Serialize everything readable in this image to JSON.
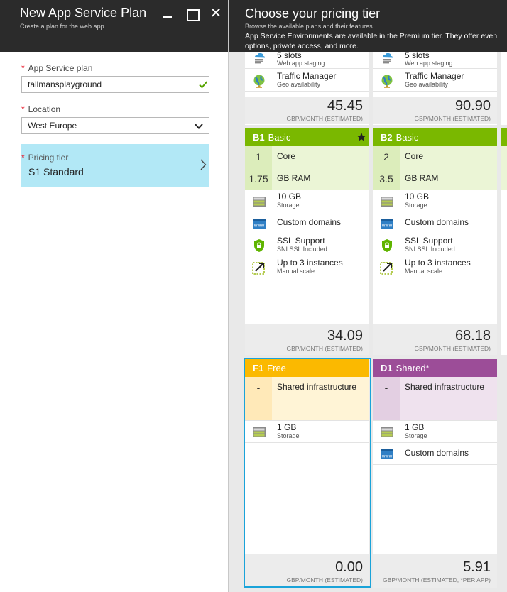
{
  "left_blade": {
    "title": "New App Service Plan",
    "subtitle": "Create a plan for the web app",
    "close_glyph": "✕",
    "required_mark": "*",
    "plan_label": "App Service plan",
    "plan_value": "tallmansplayground",
    "location_label": "Location",
    "location_value": "West Europe",
    "pricing_label": "Pricing tier",
    "pricing_value": "S1 Standard"
  },
  "right_blade": {
    "title": "Choose your pricing tier",
    "subtitle": "Browse the available plans and their features",
    "notice": "App Service Environments are available in the Premium tier. They offer even options, private access, and more."
  },
  "top_cards": [
    {
      "slots_title": "5 slots",
      "slots_sub": "Web app staging",
      "tm_title": "Traffic Manager",
      "tm_sub": "Geo availability",
      "price": "45.45",
      "unit": "GBP/MONTH (ESTIMATED)"
    },
    {
      "slots_title": "5 slots",
      "slots_sub": "Web app staging",
      "tm_title": "Traffic Manager",
      "tm_sub": "Geo availability",
      "price": "90.90",
      "unit": "GBP/MONTH (ESTIMATED)"
    }
  ],
  "basic_cards": [
    {
      "code": "B1",
      "name": "Basic",
      "core_num": "1",
      "core_label": "Core",
      "ram_num": "1.75",
      "ram_label": "GB RAM",
      "storage_title": "10 GB",
      "storage_sub": "Storage",
      "domains": "Custom domains",
      "ssl_title": "SSL Support",
      "ssl_sub": "SNI SSL Included",
      "scale_title": "Up to 3 instances",
      "scale_sub": "Manual scale",
      "price": "34.09",
      "unit": "GBP/MONTH (ESTIMATED)"
    },
    {
      "code": "B2",
      "name": "Basic",
      "core_num": "2",
      "core_label": "Core",
      "ram_num": "3.5",
      "ram_label": "GB RAM",
      "storage_title": "10 GB",
      "storage_sub": "Storage",
      "domains": "Custom domains",
      "ssl_title": "SSL Support",
      "ssl_sub": "SNI SSL Included",
      "scale_title": "Up to 3 instances",
      "scale_sub": "Manual scale",
      "price": "68.18",
      "unit": "GBP/MONTH (ESTIMATED)"
    }
  ],
  "free_card": {
    "code": "F1",
    "name": "Free",
    "dash": "-",
    "infra": "Shared infrastructure",
    "storage_title": "1 GB",
    "storage_sub": "Storage",
    "price": "0.00",
    "unit": "GBP/MONTH (ESTIMATED)"
  },
  "shared_card": {
    "code": "D1",
    "name": "Shared*",
    "dash": "-",
    "infra": "Shared infrastructure",
    "storage_title": "1 GB",
    "storage_sub": "Storage",
    "domains": "Custom domains",
    "price": "5.91",
    "unit": "GBP/MONTH (ESTIMATED, *PER APP)"
  },
  "colors": {
    "basic": "#7ab800",
    "basic_light": "#ebf5d6",
    "free": "#fbb900",
    "free_light": "#fff4d6",
    "shared": "#9c4d98",
    "shared_light": "#efe2ee",
    "selection": "#1aa3d9",
    "header_bg": "#2b2b2b"
  },
  "icons": [
    "check-icon",
    "chevron-down-icon",
    "chevron-right-icon",
    "star-icon",
    "cloud-slots-icon",
    "globe-icon",
    "storage-icon",
    "www-icon",
    "ssl-shield-icon",
    "scale-icon"
  ]
}
